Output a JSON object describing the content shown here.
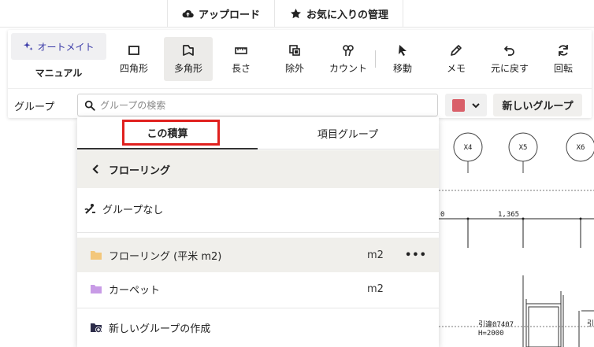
{
  "topbar": {
    "upload_label": "アップロード",
    "favorites_label": "お気に入りの管理"
  },
  "toolbar": {
    "mode_auto": "オートメイト",
    "mode_manual": "マニュアル",
    "tools": [
      {
        "label": "四角形",
        "icon": "rectangle-icon"
      },
      {
        "label": "多角形",
        "icon": "polygon-icon",
        "active": true
      },
      {
        "label": "長さ",
        "icon": "ruler-icon"
      },
      {
        "label": "除外",
        "icon": "exclude-icon"
      },
      {
        "label": "カウント",
        "icon": "count-icon"
      },
      {
        "label": "移動",
        "icon": "cursor-icon"
      },
      {
        "label": "メモ",
        "icon": "pen-icon"
      },
      {
        "label": "元に戻す",
        "icon": "undo-icon"
      },
      {
        "label": "回転",
        "icon": "rotate-icon"
      }
    ],
    "group_label": "グループ",
    "search_placeholder": "グループの検索",
    "new_group_label": "新しいグループ",
    "accent_color": "#d9606a"
  },
  "dropdown": {
    "tabs": [
      {
        "label": "この積算",
        "active": true
      },
      {
        "label": "項目グループ"
      }
    ],
    "back_label": "フローリング",
    "no_group_label": "グループなし",
    "items": [
      {
        "label": "フローリング (平米 m2)",
        "unit": "m2",
        "folder_color": "#f3c77b",
        "selected": true,
        "more": "•••"
      },
      {
        "label": "カーペット",
        "unit": "m2",
        "folder_color": "#c89be6"
      }
    ],
    "create_label": "新しいグループの作成"
  },
  "drawing": {
    "grid_labels": [
      "X4",
      "X5",
      "X6"
    ],
    "dim_left": "0",
    "dim_value": "1,365",
    "note_line1": "引違07407",
    "note_line2": "H=2000",
    "edge_text": "引"
  }
}
